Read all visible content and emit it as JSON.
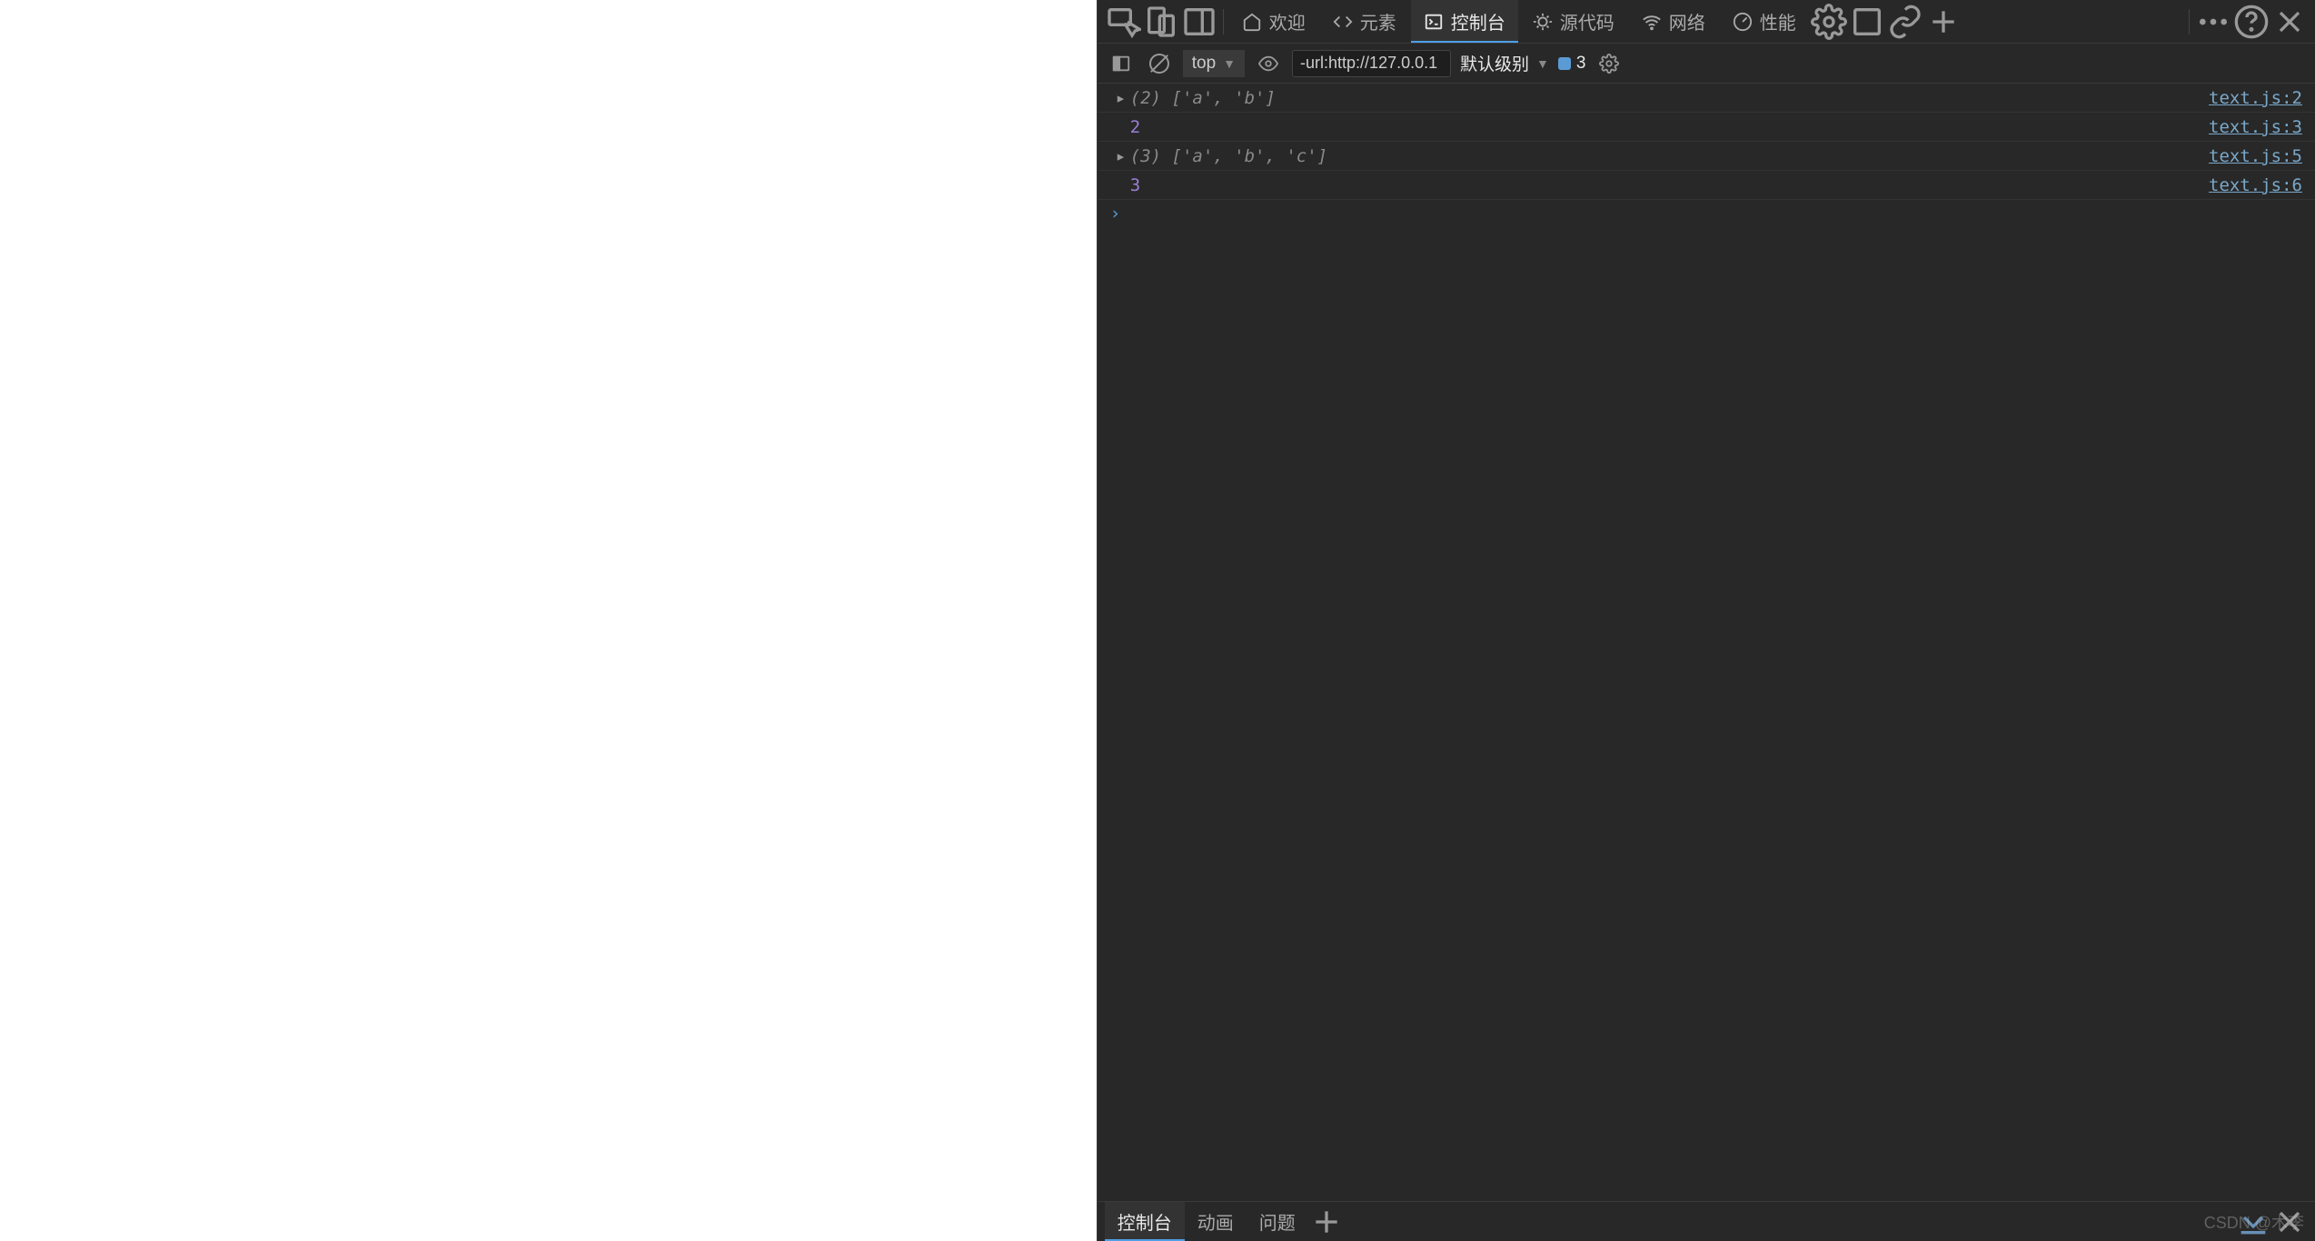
{
  "tabs": {
    "welcome": "欢迎",
    "elements": "元素",
    "console": "控制台",
    "sources": "源代码",
    "network": "网络",
    "performance": "性能"
  },
  "toolbar": {
    "context": "top",
    "filter_value": "-url:http://127.0.0.1",
    "level": "默认级别",
    "info_count": "3"
  },
  "logs": [
    {
      "type": "array",
      "count": "(2)",
      "items": "['a', 'b']",
      "src": "text.js:2"
    },
    {
      "type": "num",
      "value": "2",
      "src": "text.js:3"
    },
    {
      "type": "array",
      "count": "(3)",
      "items": "['a', 'b', 'c']",
      "src": "text.js:5"
    },
    {
      "type": "num",
      "value": "3",
      "src": "text.js:6"
    }
  ],
  "drawer": {
    "console": "控制台",
    "animations": "动画",
    "issues": "问题"
  },
  "watermark": "CSDN @木李"
}
